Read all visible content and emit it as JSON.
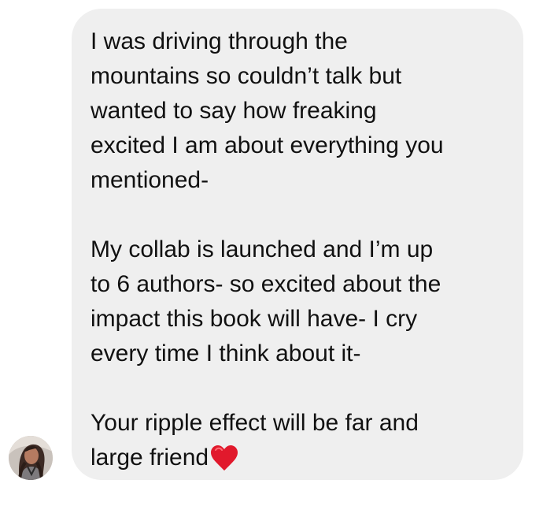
{
  "message": {
    "paragraphs": [
      "I was driving through the\nmountains so couldn’t talk but\nwanted to say how freaking\nexcited I am about everything you\nmentioned-",
      "My collab is launched and I’m up\nto 6 authors- so excited about the\nimpact this book will have- I cry\nevery time I think about it-",
      "Your ripple effect will be far and\nlarge friend"
    ],
    "emoji": "heart-icon"
  },
  "colors": {
    "bubble": "#efefef",
    "text": "#111111",
    "heart": "#e1192c",
    "background": "#ffffff"
  },
  "avatar": {
    "icon": "profile-photo"
  }
}
